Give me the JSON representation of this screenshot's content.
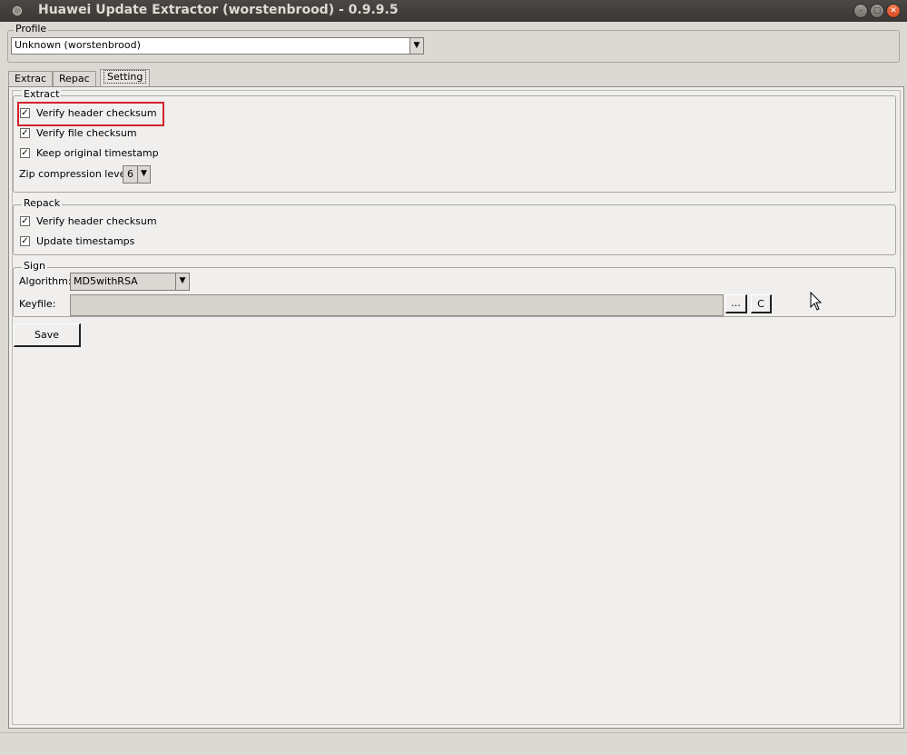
{
  "window": {
    "title": "Huawei Update Extractor (worstenbrood) - 0.9.9.5",
    "minimize_glyph": "–",
    "maximize_glyph": "▢",
    "close_glyph": "✕"
  },
  "profile": {
    "legend": "Profile",
    "selected": "Unknown (worstenbrood)"
  },
  "tabs": [
    {
      "label": "Extrac",
      "active": false
    },
    {
      "label": "Repac",
      "active": false
    },
    {
      "label": "Setting",
      "active": true
    }
  ],
  "extract": {
    "legend": "Extract",
    "verify_header_checksum": {
      "label": "Verify header checksum",
      "checked": true
    },
    "verify_file_checksum": {
      "label": "Verify file checksum",
      "checked": true
    },
    "keep_original_timestamp": {
      "label": "Keep original timestamp",
      "checked": true
    },
    "zip_level_label": "Zip compression level:",
    "zip_level_value": "6"
  },
  "repack": {
    "legend": "Repack",
    "verify_header_checksum": {
      "label": "Verify header checksum",
      "checked": true
    },
    "update_timestamps": {
      "label": "Update timestamps",
      "checked": true
    }
  },
  "sign": {
    "legend": "Sign",
    "algorithm_label": "Algorithm:",
    "algorithm_value": "MD5withRSA",
    "keyfile_label": "Keyfile:",
    "keyfile_value": "",
    "browse_label": "...",
    "clear_label": "C"
  },
  "save_label": "Save",
  "check_glyph": "✓",
  "dropdown_glyph": "▼",
  "colors": {
    "highlight_border": "#d3222a",
    "titlebar": "#3c3b37"
  }
}
